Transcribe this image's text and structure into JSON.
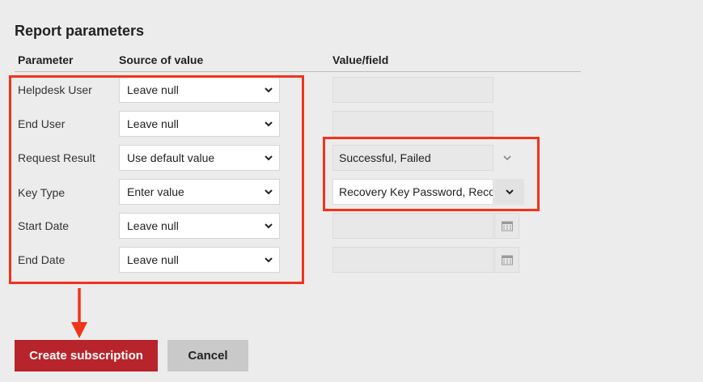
{
  "section_title": "Report parameters",
  "columns": {
    "parameter": "Parameter",
    "source": "Source of value",
    "value": "Value/field"
  },
  "rows": [
    {
      "label": "Helpdesk User",
      "source": "Leave null",
      "value": ""
    },
    {
      "label": "End User",
      "source": "Leave null",
      "value": ""
    },
    {
      "label": "Request Result",
      "source": "Use default value",
      "value": "Successful, Failed"
    },
    {
      "label": "Key Type",
      "source": "Enter value",
      "value": "Recovery Key Password, Recovery"
    },
    {
      "label": "Start Date",
      "source": "Leave null",
      "value": ""
    },
    {
      "label": "End Date",
      "source": "Leave null",
      "value": ""
    }
  ],
  "buttons": {
    "create": "Create subscription",
    "cancel": "Cancel"
  },
  "colors": {
    "highlight": "#f0341a",
    "primary_button": "#b8242b",
    "secondary_button": "#c9c9c9"
  },
  "icons": {
    "dropdown": "chevron-down-icon",
    "date": "calendar-icon"
  }
}
